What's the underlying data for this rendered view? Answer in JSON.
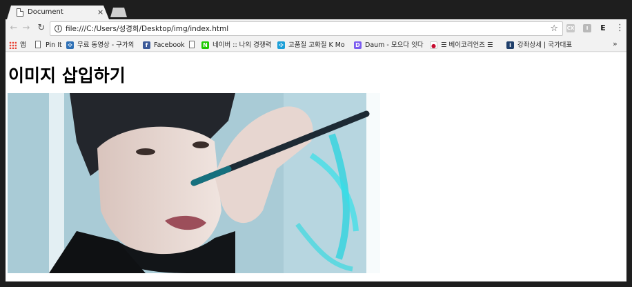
{
  "tab": {
    "title": "Document",
    "close": "×"
  },
  "toolbar": {
    "back": "←",
    "forward": "→",
    "reload": "↻",
    "url": "file:///C:/Users/성경희/Desktop/img/index.html",
    "star": "☆",
    "ext1": "CX",
    "ext2": "I",
    "ext3": "E",
    "menu": "⋮"
  },
  "bookmarks": {
    "items": [
      {
        "label": "앱"
      },
      {
        "label": "Pin It"
      },
      {
        "label": "무료 동영상 - 구가의"
      },
      {
        "label": "Facebook"
      },
      {
        "label": ""
      },
      {
        "label": "네이버 :: 나의 경쟁력"
      },
      {
        "label": "고품질 고화질 K Mo"
      },
      {
        "label": "Daum - 모으다 잇다"
      },
      {
        "label": "☰ 베이코리언즈 ☰"
      },
      {
        "label": "강좌상세 | 국가대표"
      }
    ],
    "more": "»"
  },
  "page": {
    "heading": "이미지 삽입하기"
  },
  "colors": {
    "frame": "#1e1e1e",
    "chrome": "#f2f2f2",
    "facebook": "#3b5998",
    "naver": "#1ec800"
  }
}
